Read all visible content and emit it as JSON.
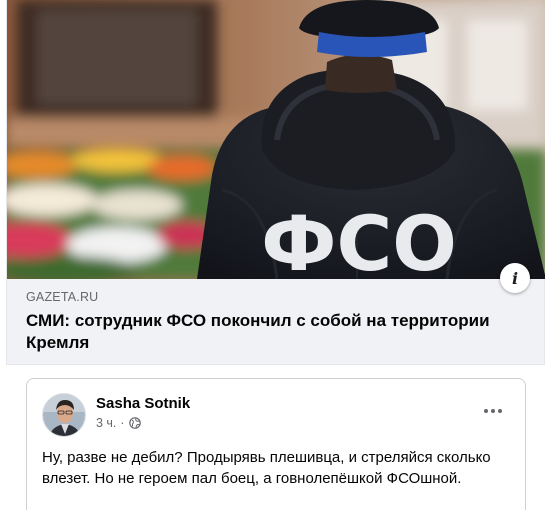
{
  "link_preview": {
    "domain": "GAZETA.RU",
    "headline": "СМИ: сотрудник ФСО покончил с собой на территории Кремля",
    "jacket_text": "ФСО",
    "info_icon": "i"
  },
  "shared_post": {
    "author": "Sasha Sotnik",
    "time": "3 ч.",
    "separator": "·",
    "privacy_icon": "globe-icon",
    "text": "Ну, разве не дебил? Продырявь плешивца, и стреляйся сколько влезет. Но не героем пал боец, а говнолепёшкой ФСОшной."
  },
  "colors": {
    "card_bg": "#f0f2f5",
    "text_primary": "#050505",
    "text_secondary": "#65676b",
    "cap_band": "#2a55b8"
  }
}
